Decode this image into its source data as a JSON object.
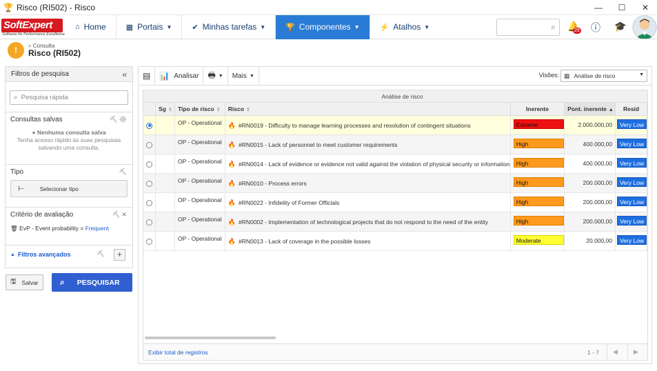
{
  "window": {
    "title": "Risco (RI502) - Risco",
    "minimize": "—",
    "maximize": "☐",
    "close": "✕"
  },
  "brand": {
    "name_soft": "Soft",
    "name_expert": "Expert",
    "tagline": "Software for Performance Excellence"
  },
  "nav": {
    "items": [
      {
        "label": "Home",
        "icon": "home-icon"
      },
      {
        "label": "Portais",
        "icon": "grid-icon"
      },
      {
        "label": "Minhas tarefas",
        "icon": "check-icon"
      },
      {
        "label": "Componentes",
        "icon": "trophy-icon"
      },
      {
        "label": "Atalhos",
        "icon": "bolt-icon"
      }
    ],
    "notification_count": "29"
  },
  "page": {
    "crumb": "Consulta",
    "title": "Risco (RI502)"
  },
  "filters": {
    "header": "Filtros de pesquisa",
    "quick_search_placeholder": "Pesquisa rápida",
    "saved_title": "Consultas salvas",
    "saved_empty_title": "Nenhuma consulta salva",
    "saved_empty_line1": "Tenha acesso rápido às suas pesquisas",
    "saved_empty_line2": "salvando uma consulta.",
    "type_title": "Tipo",
    "select_type": "Selecionar tipo",
    "criteria_title": "Critério de avaliação",
    "criteria_text": "EvP - Event probability = ",
    "criteria_value": "Frequent",
    "advanced": "Filtros avançados",
    "save": "Salvar",
    "search": "PESQUISAR"
  },
  "toolbar": {
    "analyze": "Analisar",
    "more": "Mais",
    "views_label": "Visões:",
    "views_value": "Análise de risco"
  },
  "table": {
    "group_header": "Análise de risco",
    "columns": [
      "Sg",
      "Tipo de risco",
      "Risco",
      "Inerente",
      "Pont. inerente",
      "Resid"
    ],
    "rows": [
      {
        "type": "OP - Operational",
        "risk": "#RN0019 - Difficulty to manage learning processes and resolution of contingent situations",
        "inherent": "Extreme",
        "score": "2.000.000,00",
        "residual": "Very Low",
        "selected": true
      },
      {
        "type": "OP - Operational",
        "risk": "#RN0015 - Lack of personnel to meet customer requirements",
        "inherent": "High",
        "score": "400.000,00",
        "residual": "Very Low",
        "selected": false
      },
      {
        "type": "OP - Operational",
        "risk": "#RN0014 - Lack of evidence or evidence not valid against the violation of physical security or information",
        "inherent": "High",
        "score": "400.000,00",
        "residual": "Very Low",
        "selected": false
      },
      {
        "type": "OP - Operational",
        "risk": "#RN0010 - Process errors",
        "inherent": "High",
        "score": "200.000,00",
        "residual": "Very Low",
        "selected": false
      },
      {
        "type": "OP - Operational",
        "risk": "#RN0022 - Infidelity of Former Officials",
        "inherent": "High",
        "score": "200.000,00",
        "residual": "Very Low",
        "selected": false
      },
      {
        "type": "OP - Operational",
        "risk": "#RN0002 - Implementation of technological projects that do not respond to the need of the entity",
        "inherent": "High",
        "score": "200.000,00",
        "residual": "Very Low",
        "selected": false
      },
      {
        "type": "OP - Operational",
        "risk": "#RN0013 - Lack of coverage in the possible losses",
        "inherent": "Moderate",
        "score": "20.000,00",
        "residual": "Very Low",
        "selected": false
      }
    ],
    "footer_link": "Exibir total de registros",
    "pager": "1 - 7"
  },
  "colors": {
    "accent": "#2a7bd5",
    "extreme": "#ee1111",
    "high": "#ff9a1e",
    "moderate": "#ffff33",
    "very_low": "#1e6fe0"
  }
}
